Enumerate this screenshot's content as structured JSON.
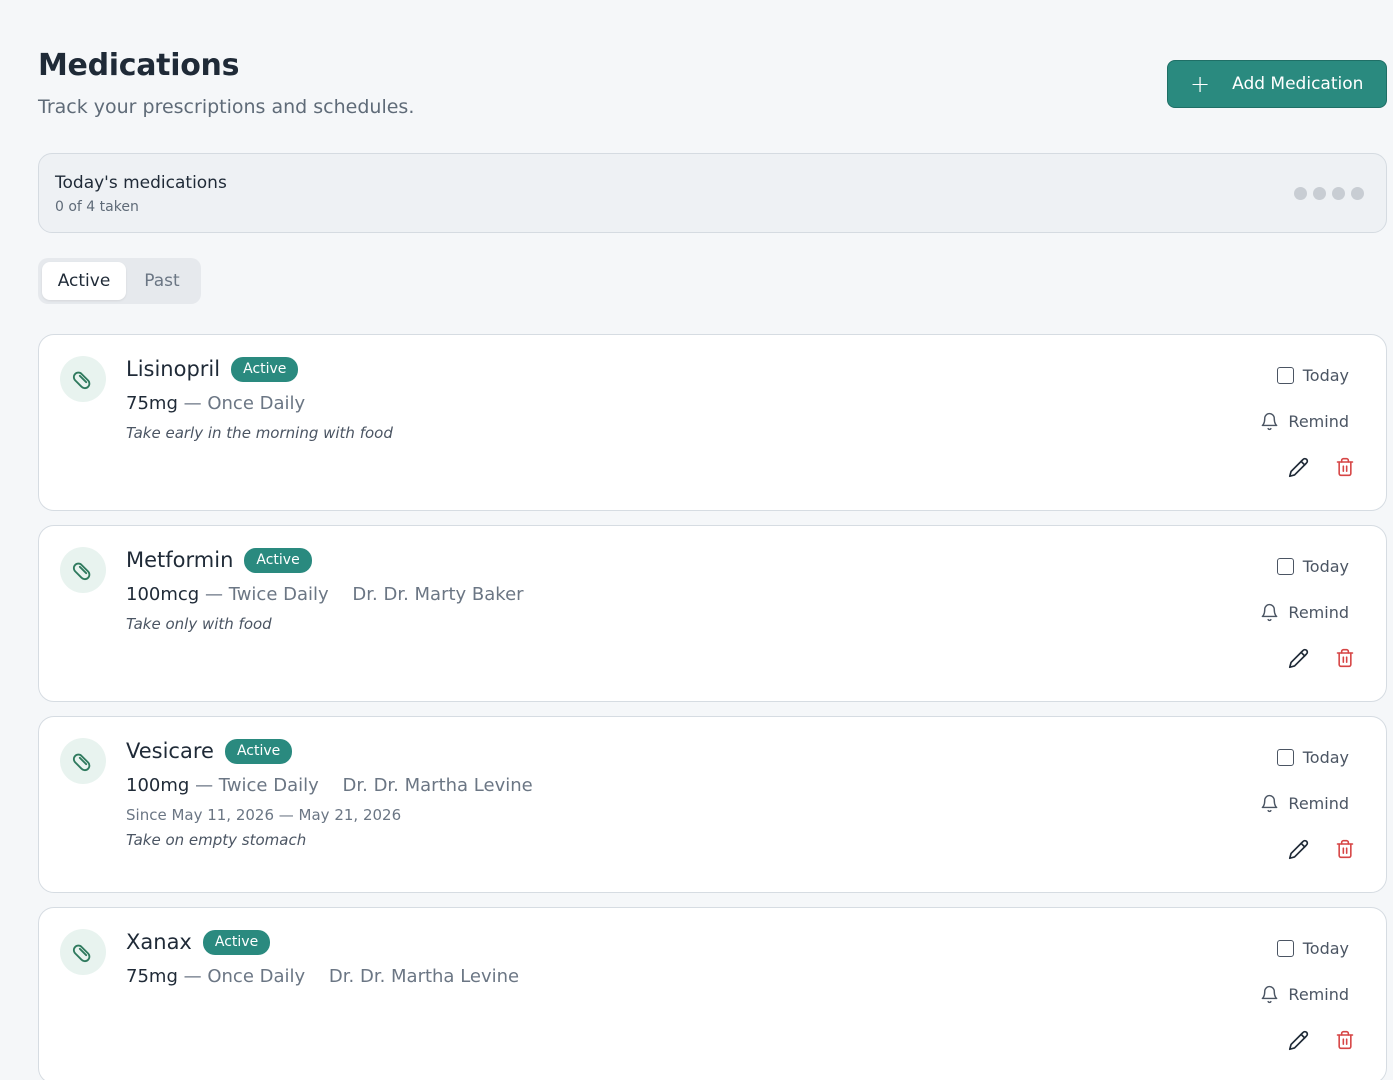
{
  "header": {
    "title": "Medications",
    "subtitle": "Track your prescriptions and schedules.",
    "add_button": "Add Medication"
  },
  "summary": {
    "title": "Today's medications",
    "count": "0 of 4 taken",
    "total": 4,
    "taken": 0
  },
  "tabs": [
    {
      "label": "Active",
      "selected": true
    },
    {
      "label": "Past",
      "selected": false
    }
  ],
  "actions": {
    "today_label": "Today",
    "remind_label": "Remind"
  },
  "colors": {
    "accent": "#2a8a7f",
    "danger": "#d64545",
    "pill_bg": "#e8f3ef"
  },
  "medications": [
    {
      "name": "Lisinopril",
      "status": "Active",
      "dose": "75mg",
      "frequency": "Once Daily",
      "doctor": "",
      "since": "",
      "note": "Take early in the morning with food"
    },
    {
      "name": "Metformin",
      "status": "Active",
      "dose": "100mcg",
      "frequency": "Twice Daily",
      "doctor": "Dr. Dr. Marty Baker",
      "since": "",
      "note": "Take only with food"
    },
    {
      "name": "Vesicare",
      "status": "Active",
      "dose": "100mg",
      "frequency": "Twice Daily",
      "doctor": "Dr. Dr. Martha Levine",
      "since": "Since May 11, 2026 — May 21, 2026",
      "note": "Take on empty stomach"
    },
    {
      "name": "Xanax",
      "status": "Active",
      "dose": "75mg",
      "frequency": "Once Daily",
      "doctor": "Dr. Dr. Martha Levine",
      "since": "",
      "note": ""
    }
  ]
}
